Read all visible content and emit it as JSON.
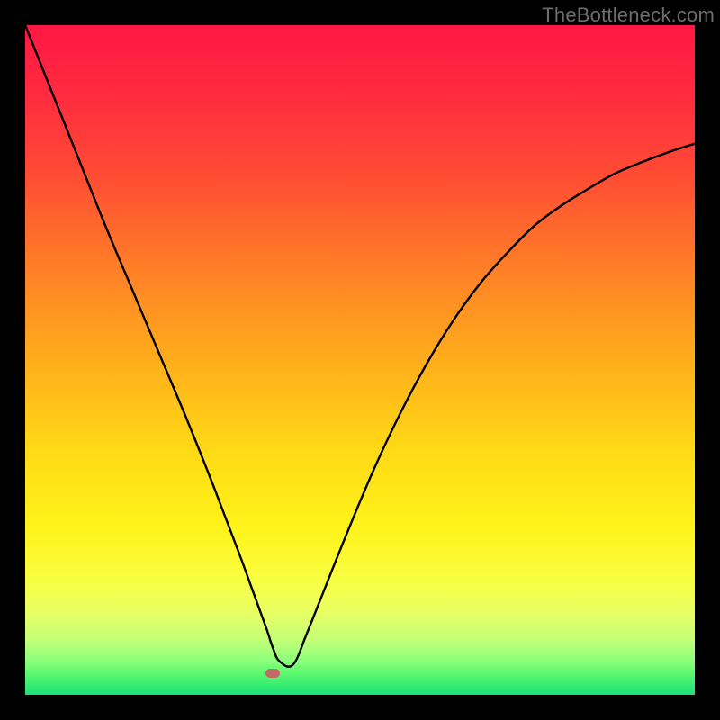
{
  "watermark": {
    "text": "TheBottleneck.com"
  },
  "chart_data": {
    "type": "line",
    "title": "",
    "xlabel": "",
    "ylabel": "",
    "xlim": [
      0,
      100
    ],
    "ylim": [
      0,
      100
    ],
    "series": [
      {
        "name": "curve",
        "x": [
          0,
          4,
          8,
          12,
          16,
          20,
          24,
          28,
          32,
          34,
          36,
          37,
          38,
          40,
          42,
          44,
          48,
          52,
          56,
          60,
          64,
          68,
          72,
          76,
          80,
          84,
          88,
          92,
          96,
          100
        ],
        "y": [
          100,
          90,
          80,
          70,
          60.5,
          51,
          41.5,
          31.5,
          21,
          15.5,
          10,
          7,
          5,
          4.5,
          9,
          14,
          24,
          33.5,
          42,
          49.5,
          56,
          61.5,
          66,
          70,
          73,
          75.5,
          77.8,
          79.5,
          81,
          82.3
        ]
      }
    ],
    "background_gradient_stops": [
      {
        "pos": 0,
        "color": "#ff1744"
      },
      {
        "pos": 0.1,
        "color": "#ff2a3f"
      },
      {
        "pos": 0.22,
        "color": "#ff4a34"
      },
      {
        "pos": 0.35,
        "color": "#ff7a28"
      },
      {
        "pos": 0.5,
        "color": "#ffad1c"
      },
      {
        "pos": 0.63,
        "color": "#ffd816"
      },
      {
        "pos": 0.75,
        "color": "#fff31a"
      },
      {
        "pos": 0.83,
        "color": "#f8ff42"
      },
      {
        "pos": 0.88,
        "color": "#e6ff66"
      },
      {
        "pos": 0.92,
        "color": "#c0ff78"
      },
      {
        "pos": 0.95,
        "color": "#8aff7a"
      },
      {
        "pos": 0.975,
        "color": "#4cf56e"
      },
      {
        "pos": 1.0,
        "color": "#18e07a"
      }
    ],
    "marker": {
      "x": 37,
      "y": 3.2
    }
  }
}
